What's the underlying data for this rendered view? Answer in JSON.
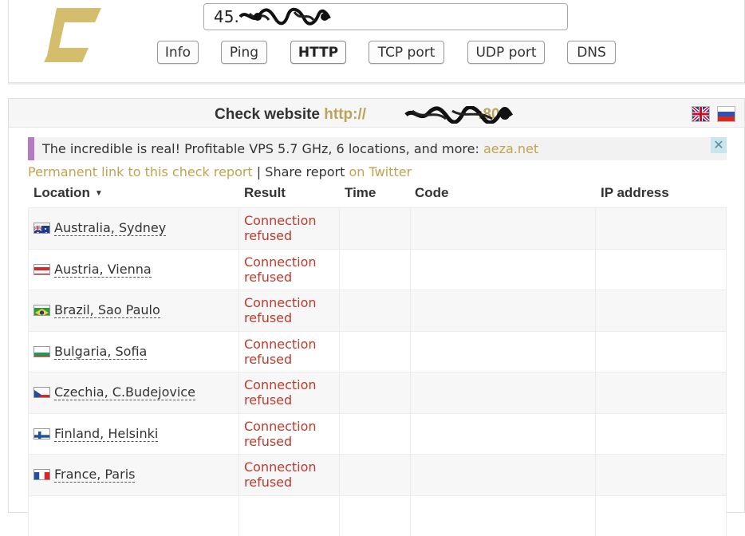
{
  "header": {
    "host_value": "45.",
    "tools": [
      {
        "label": "Info",
        "active": false
      },
      {
        "label": "Ping",
        "active": false
      },
      {
        "label": "HTTP",
        "active": true
      },
      {
        "label": "TCP port",
        "active": false
      },
      {
        "label": "UDP port",
        "active": false
      },
      {
        "label": "DNS",
        "active": false
      }
    ],
    "logo_color": "#d4be6e"
  },
  "check": {
    "title_prefix": "Check website",
    "url_start": "http://",
    "url_end": ":80",
    "languages": [
      "en",
      "ru"
    ]
  },
  "ad": {
    "text": "The incredible is real! Profitable VPS 5.7 GHz, 6 locations, and more:",
    "link": "aeza.net",
    "close": "✕",
    "accent_color": "#b47bc2"
  },
  "links": {
    "permanent": "Permanent link to this check report",
    "separator": "|",
    "share": "Share report",
    "twitter": "on Twitter"
  },
  "table": {
    "columns": {
      "location": "Location",
      "sort_indicator": "▼",
      "result": "Result",
      "time": "Time",
      "code": "Code",
      "ip": "IP address"
    },
    "rows": [
      {
        "location": "Australia, Sydney",
        "result_line1": "Connection",
        "result_line2": "refused",
        "flag": "australia-flag"
      },
      {
        "location": "Austria, Vienna",
        "result_line1": "Connection",
        "result_line2": "refused",
        "flag": "austria-flag"
      },
      {
        "location": "Brazil, Sao Paulo",
        "result_line1": "Connection",
        "result_line2": "refused",
        "flag": "brazil-flag"
      },
      {
        "location": "Bulgaria, Sofia",
        "result_line1": "Connection",
        "result_line2": "refused",
        "flag": "bulgaria-flag"
      },
      {
        "location": "Czechia, C.Budejovice",
        "result_line1": "Connection",
        "result_line2": "refused",
        "flag": "czechia-flag"
      },
      {
        "location": "Finland, Helsinki",
        "result_line1": "Connection",
        "result_line2": "refused",
        "flag": "finland-flag"
      },
      {
        "location": "France, Paris",
        "result_line1": "Connection",
        "result_line2": "refused",
        "flag": "france-flag"
      }
    ]
  },
  "colors": {
    "gold": "#c2a24e",
    "error_red": "#c0392b"
  }
}
